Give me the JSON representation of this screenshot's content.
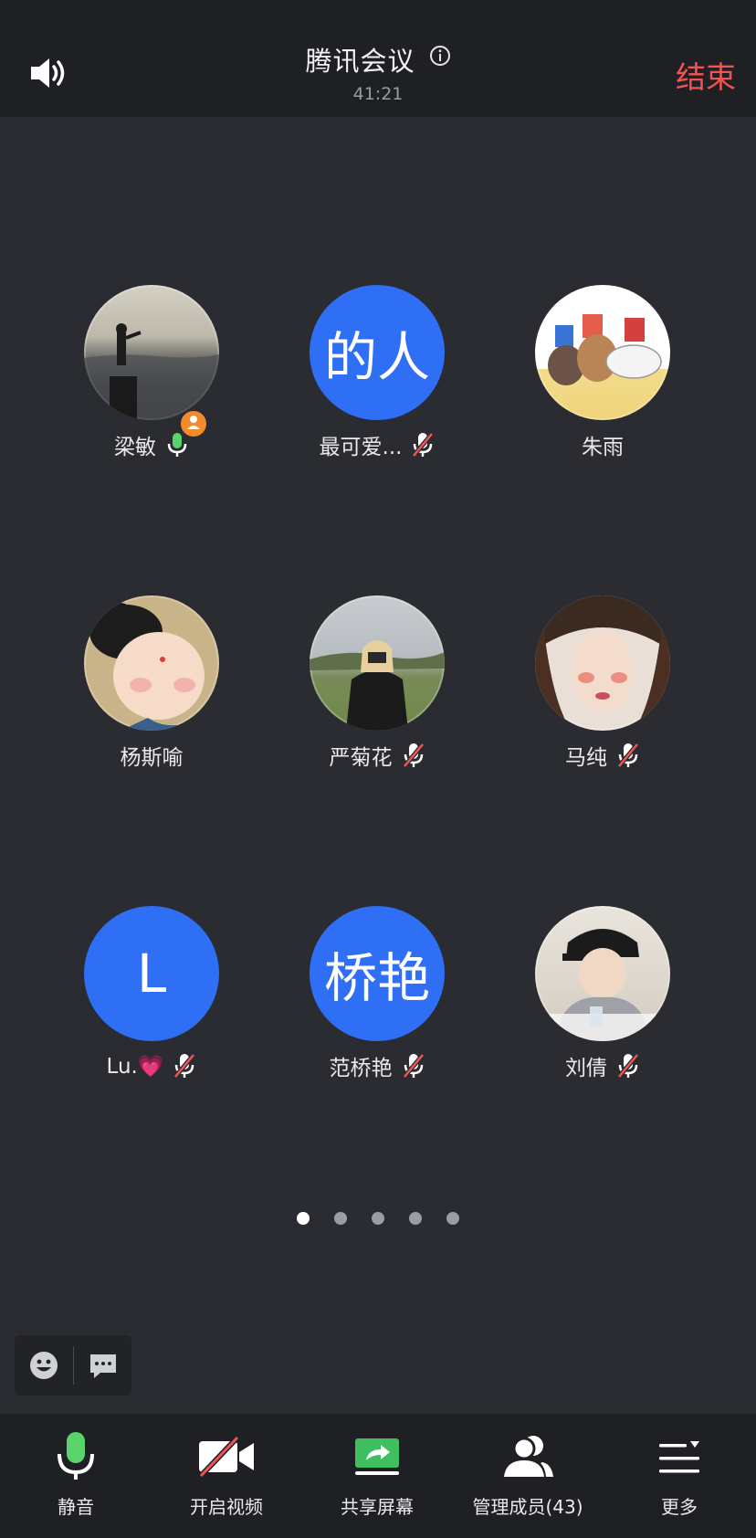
{
  "header": {
    "title": "腾讯会议",
    "timer": "41:21",
    "end_label": "结束"
  },
  "participants": [
    {
      "name": "梁敏",
      "avatar_text": "",
      "avatar_type": "photo",
      "mic": "on",
      "host": true
    },
    {
      "name": "最可爱...",
      "avatar_text": "的人",
      "avatar_type": "blue",
      "mic": "muted",
      "host": false
    },
    {
      "name": "朱雨",
      "avatar_text": "",
      "avatar_type": "photo",
      "mic": "none",
      "host": false
    },
    {
      "name": "杨斯喻",
      "avatar_text": "",
      "avatar_type": "photo",
      "mic": "none",
      "host": false
    },
    {
      "name": "严菊花",
      "avatar_text": "",
      "avatar_type": "photo",
      "mic": "muted",
      "host": false
    },
    {
      "name": "马纯",
      "avatar_text": "",
      "avatar_type": "photo",
      "mic": "muted",
      "host": false
    },
    {
      "name": "Lu.💗",
      "avatar_text": "L",
      "avatar_type": "blue",
      "mic": "muted",
      "host": false
    },
    {
      "name": "范桥艳",
      "avatar_text": "桥艳",
      "avatar_type": "blue",
      "mic": "muted",
      "host": false
    },
    {
      "name": "刘倩",
      "avatar_text": "",
      "avatar_type": "photo",
      "mic": "muted",
      "host": false
    }
  ],
  "pagination": {
    "pages": 5,
    "current": 1
  },
  "toolbar": {
    "mute_label": "静音",
    "video_label": "开启视频",
    "share_label": "共享屏幕",
    "members_label": "管理成员(43)",
    "more_label": "更多"
  },
  "colors": {
    "accent_blue": "#2f6ff5",
    "end_red": "#f05454",
    "mic_green": "#5ad36b",
    "background": "#2a2c31"
  },
  "icons": [
    "speaker-icon",
    "info-icon",
    "mic-icon",
    "mic-muted-icon",
    "emoji-icon",
    "chat-icon",
    "video-off-icon",
    "share-screen-icon",
    "members-icon",
    "more-icon"
  ]
}
